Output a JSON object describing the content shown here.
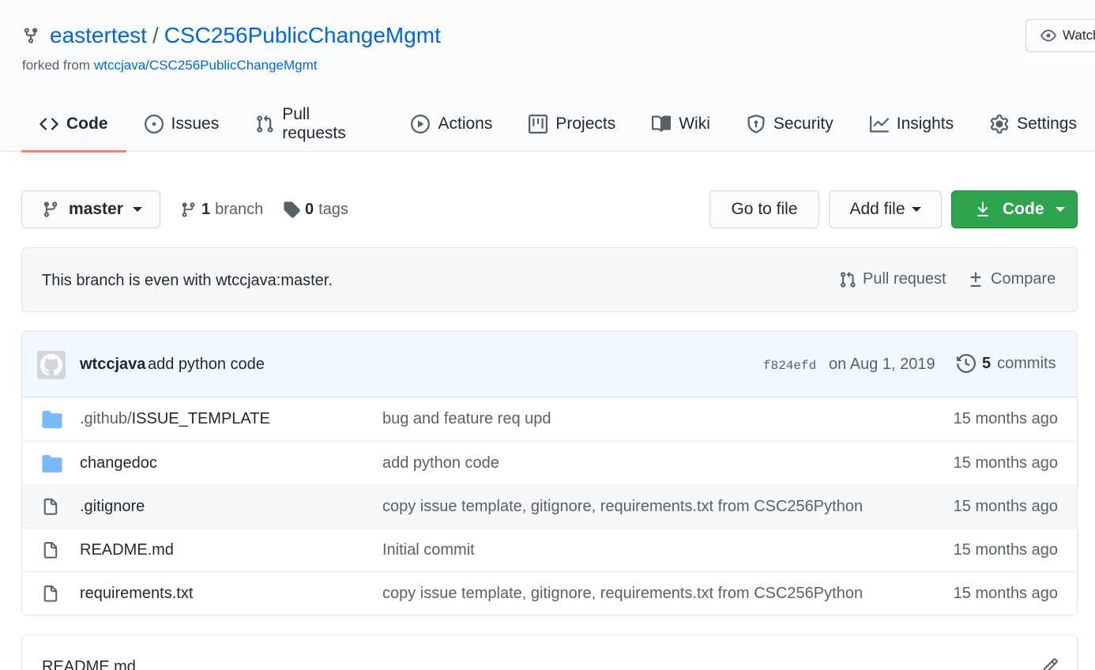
{
  "repo": {
    "owner": "eastertest",
    "separator": "/",
    "name": "CSC256PublicChangeMgmt",
    "forked_prefix": "forked from",
    "forked_source": "wtccjava/CSC256PublicChangeMgmt",
    "watch_label": "Watch"
  },
  "tabs": [
    {
      "label": "Code",
      "icon": "code-icon"
    },
    {
      "label": "Issues",
      "icon": "issue-icon"
    },
    {
      "label": "Pull requests",
      "icon": "pull-request-icon"
    },
    {
      "label": "Actions",
      "icon": "play-icon"
    },
    {
      "label": "Projects",
      "icon": "project-icon"
    },
    {
      "label": "Wiki",
      "icon": "book-icon"
    },
    {
      "label": "Security",
      "icon": "shield-icon"
    },
    {
      "label": "Insights",
      "icon": "graph-icon"
    },
    {
      "label": "Settings",
      "icon": "gear-icon"
    }
  ],
  "filenav": {
    "branch": "master",
    "branch_count": "1",
    "branch_label": "branch",
    "tag_count": "0",
    "tag_label": "tags",
    "goto_label": "Go to file",
    "addfile_label": "Add file",
    "code_label": "Code"
  },
  "banner": {
    "text": "This branch is even with wtccjava:master.",
    "pull_request_label": "Pull request",
    "compare_label": "Compare"
  },
  "latest_commit": {
    "author": "wtccjava",
    "message": "add python code",
    "sha": "f824efd",
    "date": "on Aug 1, 2019",
    "count": "5",
    "count_label": "commits"
  },
  "files": [
    {
      "type": "dir",
      "prefix": ".github/",
      "name": "ISSUE_TEMPLATE",
      "message": "bug and feature req upd",
      "age": "15 months ago"
    },
    {
      "type": "dir",
      "prefix": "",
      "name": "changedoc",
      "message": "add python code",
      "age": "15 months ago"
    },
    {
      "type": "file",
      "prefix": "",
      "name": ".gitignore",
      "message": "copy issue template, gitignore, requirements.txt from CSC256Python",
      "age": "15 months ago"
    },
    {
      "type": "file",
      "prefix": "",
      "name": "README.md",
      "message": "Initial commit",
      "age": "15 months ago"
    },
    {
      "type": "file",
      "prefix": "",
      "name": "requirements.txt",
      "message": "copy issue template, gitignore, requirements.txt from CSC256Python",
      "age": "15 months ago"
    }
  ],
  "readme": {
    "title": "README.md"
  },
  "colors": {
    "accent": "#0366d6",
    "primary_button": "#2ea44f",
    "tab_underline": "#f9826c",
    "folder": "#79b8ff"
  }
}
